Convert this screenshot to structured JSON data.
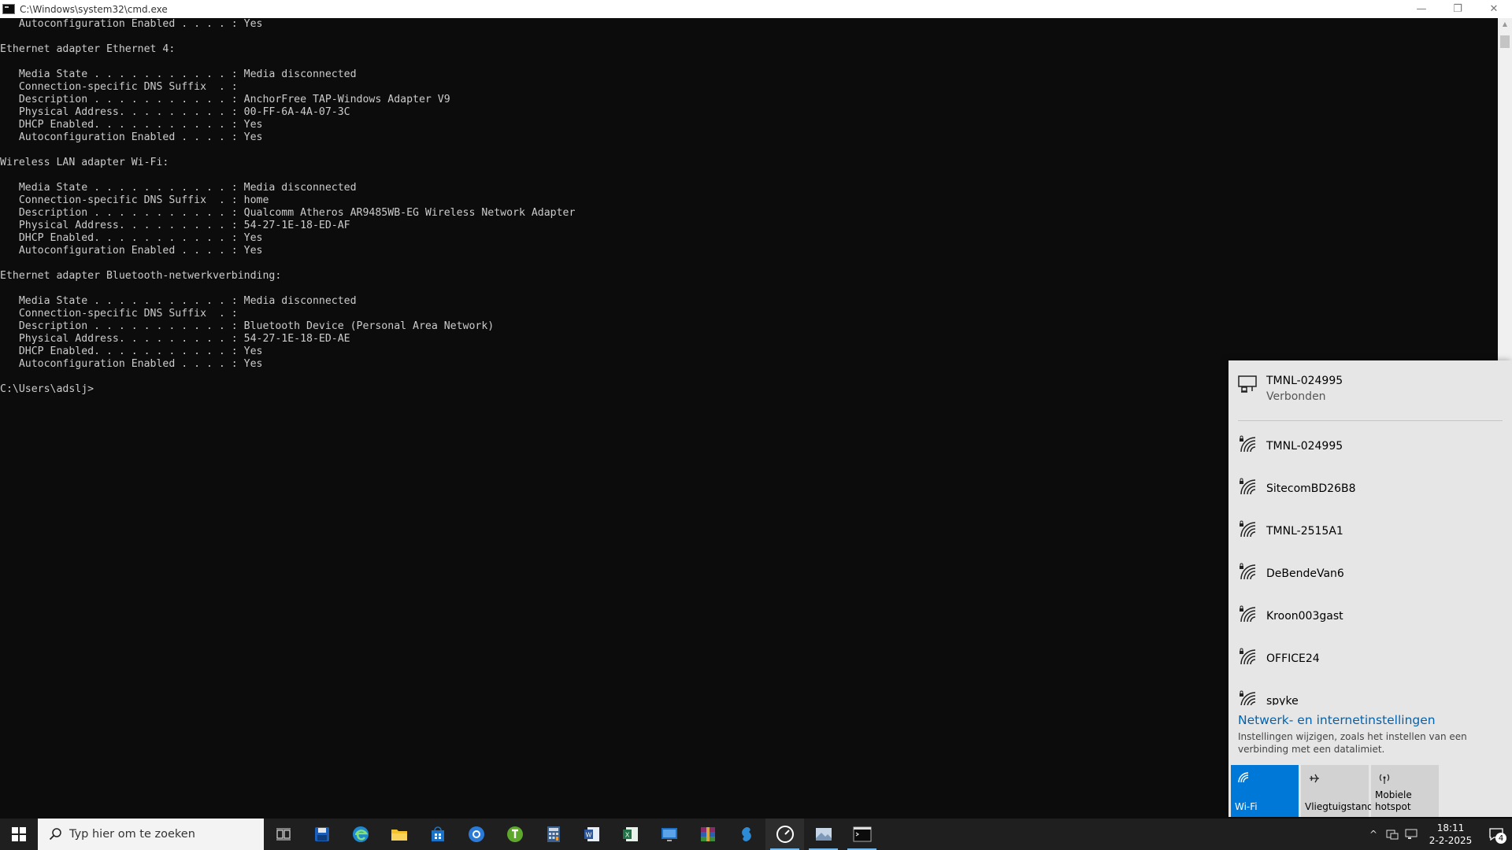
{
  "window": {
    "title": "C:\\Windows\\system32\\cmd.exe",
    "minimize_glyph": "—",
    "restore_glyph": "❐",
    "close_glyph": "✕"
  },
  "console": {
    "lines": [
      "   Autoconfiguration Enabled . . . . : Yes",
      "",
      "Ethernet adapter Ethernet 4:",
      "",
      "   Media State . . . . . . . . . . . : Media disconnected",
      "   Connection-specific DNS Suffix  . :",
      "   Description . . . . . . . . . . . : AnchorFree TAP-Windows Adapter V9",
      "   Physical Address. . . . . . . . . : 00-FF-6A-4A-07-3C",
      "   DHCP Enabled. . . . . . . . . . . : Yes",
      "   Autoconfiguration Enabled . . . . : Yes",
      "",
      "Wireless LAN adapter Wi-Fi:",
      "",
      "   Media State . . . . . . . . . . . : Media disconnected",
      "   Connection-specific DNS Suffix  . : home",
      "   Description . . . . . . . . . . . : Qualcomm Atheros AR9485WB-EG Wireless Network Adapter",
      "   Physical Address. . . . . . . . . : 54-27-1E-18-ED-AF",
      "   DHCP Enabled. . . . . . . . . . . : Yes",
      "   Autoconfiguration Enabled . . . . : Yes",
      "",
      "Ethernet adapter Bluetooth-netwerkverbinding:",
      "",
      "   Media State . . . . . . . . . . . : Media disconnected",
      "   Connection-specific DNS Suffix  . :",
      "   Description . . . . . . . . . . . : Bluetooth Device (Personal Area Network)",
      "   Physical Address. . . . . . . . . : 54-27-1E-18-ED-AE",
      "   DHCP Enabled. . . . . . . . . . . : Yes",
      "   Autoconfiguration Enabled . . . . : Yes",
      "",
      "C:\\Users\\adslj>"
    ]
  },
  "network_flyout": {
    "connected": {
      "ssid": "TMNL-024995",
      "status": "Verbonden",
      "icon": "ethernet-icon"
    },
    "networks": [
      {
        "name": "TMNL-024995",
        "icon": "wifi-secured-icon"
      },
      {
        "name": "SitecomBD26B8",
        "icon": "wifi-secured-icon"
      },
      {
        "name": "TMNL-2515A1",
        "icon": "wifi-secured-icon"
      },
      {
        "name": "DeBendeVan6",
        "icon": "wifi-secured-icon"
      },
      {
        "name": "Kroon003gast",
        "icon": "wifi-secured-icon"
      },
      {
        "name": "OFFICE24",
        "icon": "wifi-secured-icon"
      },
      {
        "name": "spyke",
        "icon": "wifi-secured-icon"
      }
    ],
    "settings_link": "Netwerk- en internetinstellingen",
    "settings_desc": "Instellingen wijzigen, zoals het instellen van een verbinding met een datalimiet.",
    "tiles": [
      {
        "label": "Wi-Fi",
        "icon": "wifi-icon",
        "active": true
      },
      {
        "label": "Vliegtuigstand",
        "icon": "airplane-icon",
        "active": false
      },
      {
        "label": "Mobiele hotspot",
        "icon": "hotspot-icon",
        "active": false
      }
    ],
    "accent_color": "#0078d7"
  },
  "taskbar": {
    "search_placeholder": "Typ hier om te zoeken",
    "apps": [
      "task-view-icon",
      "save-disk-icon",
      "edge-icon",
      "file-explorer-icon",
      "store-icon",
      "browser-icon",
      "torrent-icon",
      "calculator-icon",
      "word-icon",
      "excel-icon",
      "remote-desktop-icon",
      "winrar-icon",
      "vpn-icon",
      "speedtest-icon",
      "photos-icon",
      "cmd-icon"
    ],
    "time": "18:11",
    "date": "2-2-2025",
    "notification_count": "4",
    "tray_chevron": "^"
  }
}
